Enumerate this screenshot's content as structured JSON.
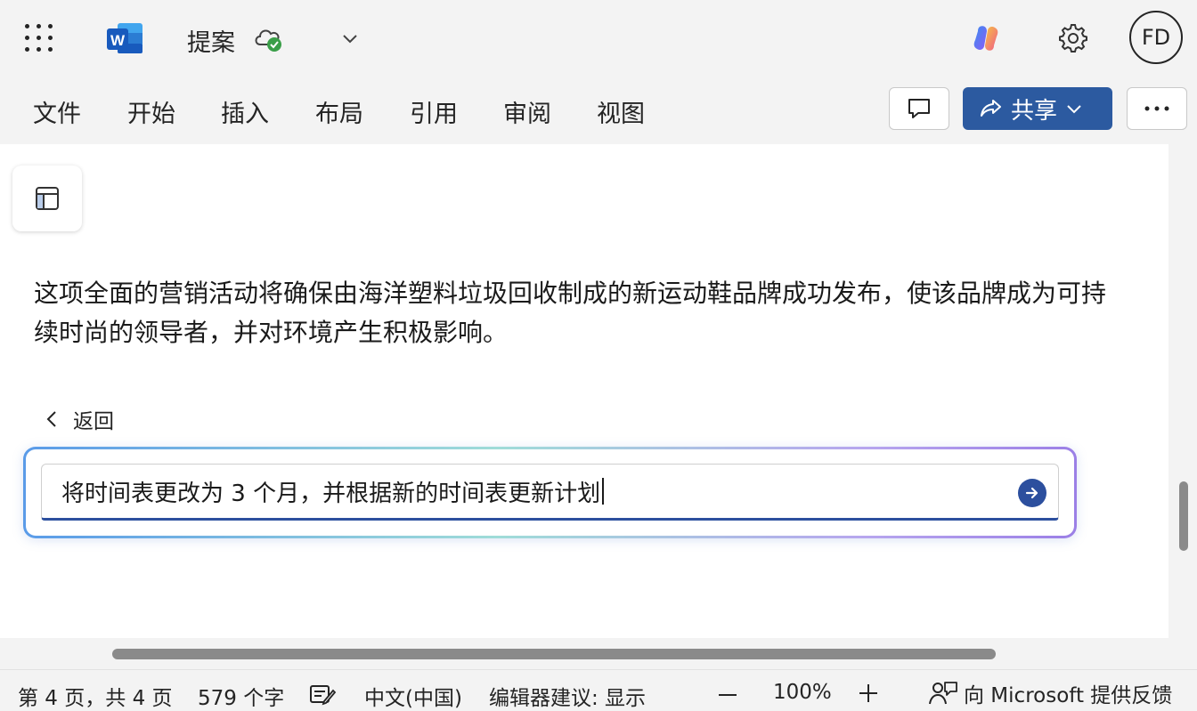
{
  "titlebar": {
    "document_title": "提案",
    "app_icon": "word-icon",
    "app_icon_letter": "W",
    "sync_icon": "cloud-synced-icon",
    "avatar_initials": "FD"
  },
  "ribbon": {
    "tabs": [
      {
        "label": "文件"
      },
      {
        "label": "开始"
      },
      {
        "label": "插入"
      },
      {
        "label": "布局"
      },
      {
        "label": "引用"
      },
      {
        "label": "审阅"
      },
      {
        "label": "视图"
      }
    ],
    "share_label": "共享"
  },
  "document": {
    "paragraph": "这项全面的营销活动将确保由海洋塑料垃圾回收制成的新运动鞋品牌成功发布，使该品牌成为可持续时尚的领导者，并对环境产生积极影响。"
  },
  "copilot_prompt": {
    "back_label": "返回",
    "input_value": "将时间表更改为 3 个月，并根据新的时间表更新计划"
  },
  "status_bar": {
    "page_info": "第 4 页，共 4 页",
    "word_count": "579 个字",
    "language": "中文(中国)",
    "editor_suggestions": "编辑器建议: 显示",
    "zoom_level": "100%",
    "feedback_label": "向 Microsoft 提供反馈"
  },
  "colors": {
    "accent": "#2c5aa0",
    "word_blue": "#185abd",
    "sync_green": "#3a9e48"
  }
}
